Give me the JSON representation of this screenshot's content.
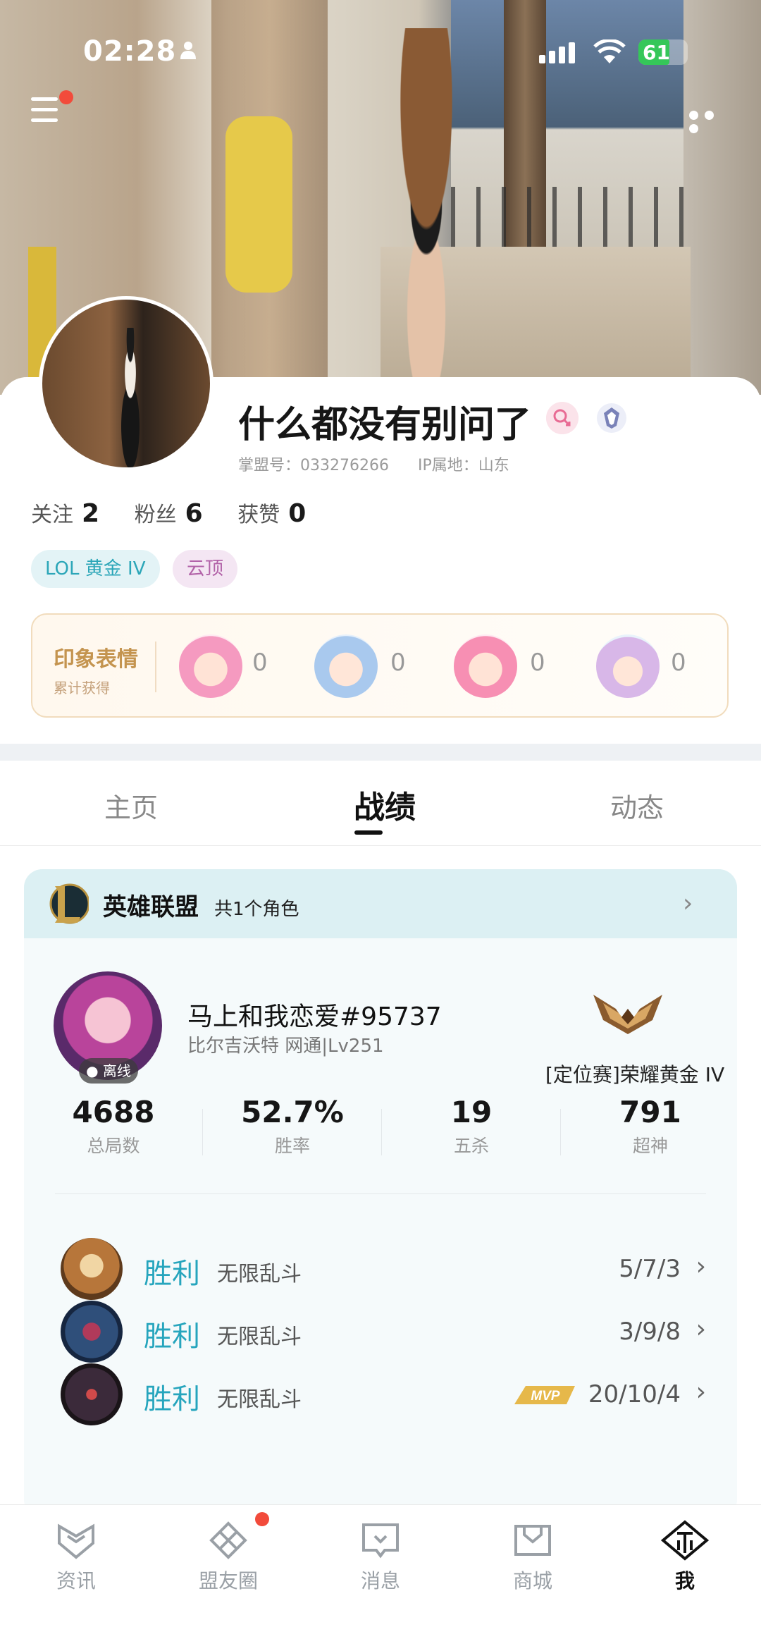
{
  "status_bar": {
    "time": "02:28",
    "battery": "61"
  },
  "profile": {
    "nickname": "什么都没有别问了",
    "account_id": "掌盟号：033276266",
    "ip_location": "IP属地：山东",
    "stats": [
      {
        "label": "关注",
        "value": "2"
      },
      {
        "label": "粉丝",
        "value": "6"
      },
      {
        "label": "获赞",
        "value": "0"
      }
    ],
    "tags": [
      "LOL 黄金 IV",
      "云顶"
    ]
  },
  "impressions": {
    "title": "印象表情",
    "subtitle": "累计获得",
    "counts": [
      "0",
      "0",
      "0",
      "0"
    ]
  },
  "tabs": [
    "主页",
    "战绩",
    "动态"
  ],
  "game": {
    "name": "英雄联盟",
    "role_count": "共1个角色",
    "summoner": "马上和我恋爱#95737",
    "server": "比尔吉沃特  网通|Lv251",
    "status": "离线",
    "rank": "[定位赛]荣耀黄金 IV",
    "stats": [
      {
        "value": "4688",
        "label": "总局数"
      },
      {
        "value": "52.7%",
        "label": "胜率"
      },
      {
        "value": "19",
        "label": "五杀"
      },
      {
        "value": "791",
        "label": "超神"
      }
    ],
    "matches": [
      {
        "result": "胜利",
        "mode": "无限乱斗",
        "kda": "5/7/3",
        "mvp": false
      },
      {
        "result": "胜利",
        "mode": "无限乱斗",
        "kda": "3/9/8",
        "mvp": false
      },
      {
        "result": "胜利",
        "mode": "无限乱斗",
        "kda": "20/10/4",
        "mvp": true
      }
    ],
    "mvp_label": "MVP"
  },
  "nav": [
    {
      "label": "资讯",
      "icon": "news-icon"
    },
    {
      "label": "盟友圈",
      "icon": "friends-circle-icon"
    },
    {
      "label": "消息",
      "icon": "message-icon"
    },
    {
      "label": "商城",
      "icon": "shop-icon"
    },
    {
      "label": "我",
      "icon": "me-icon"
    }
  ],
  "colors": {
    "accent": "#26a5bd",
    "badge": "#f24b3b"
  }
}
